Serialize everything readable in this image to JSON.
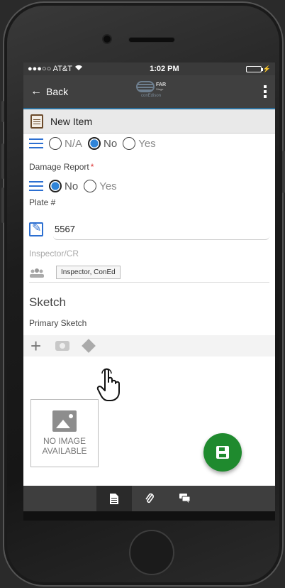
{
  "status_bar": {
    "carrier": "●●●○○ AT&T",
    "wifi": "wifi-icon",
    "time": "1:02 PM"
  },
  "app_bar": {
    "back_label": "Back",
    "logo_far": "FAR",
    "logo_stage": "Stage",
    "logo_sub": "conEdison"
  },
  "title_bar": {
    "title": "New Item"
  },
  "form": {
    "top_radio": {
      "options": [
        "N/A",
        "No",
        "Yes"
      ],
      "selected": "No"
    },
    "damage_report": {
      "label": "Damage Report",
      "required_mark": "*",
      "options": [
        "No",
        "Yes"
      ],
      "selected": "No"
    },
    "plate": {
      "label": "Plate #",
      "value": "5567"
    },
    "inspector": {
      "label": "Inspector/CR",
      "value": "Inspector, ConEd"
    },
    "sketch": {
      "section_title": "Sketch",
      "sub_label": "Primary Sketch",
      "no_image_line1": "NO IMAGE",
      "no_image_line2": "AVAILABLE"
    }
  },
  "colors": {
    "accent_blue": "#2f84d8",
    "fab_green": "#1f8a2e",
    "app_bar": "#404040"
  }
}
